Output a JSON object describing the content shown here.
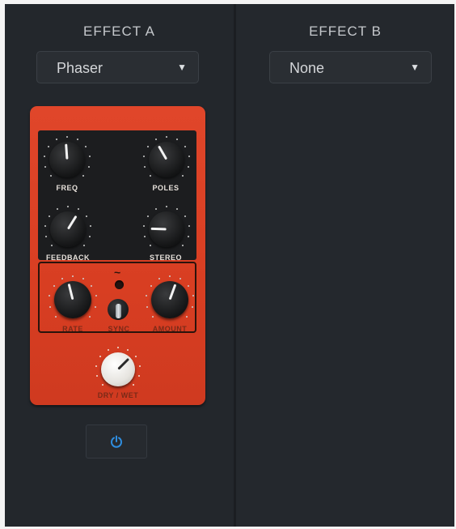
{
  "effect_a": {
    "label": "EFFECT A",
    "selected": "Phaser",
    "pedal": {
      "knobs": {
        "freq": "FREQ",
        "poles": "POLES",
        "feedback": "FEEDBACK",
        "stereo": "STEREO",
        "rate": "RATE",
        "sync": "SYNC",
        "amount": "AMOUNT",
        "dry_wet": "DRY / WET"
      },
      "wave_symbol": "~"
    },
    "power_icon": "power-icon"
  },
  "effect_b": {
    "label": "EFFECT B",
    "selected": "None"
  },
  "colors": {
    "background": "#22262b",
    "pedal": "#d83e22",
    "power_accent": "#2f8ee0"
  }
}
